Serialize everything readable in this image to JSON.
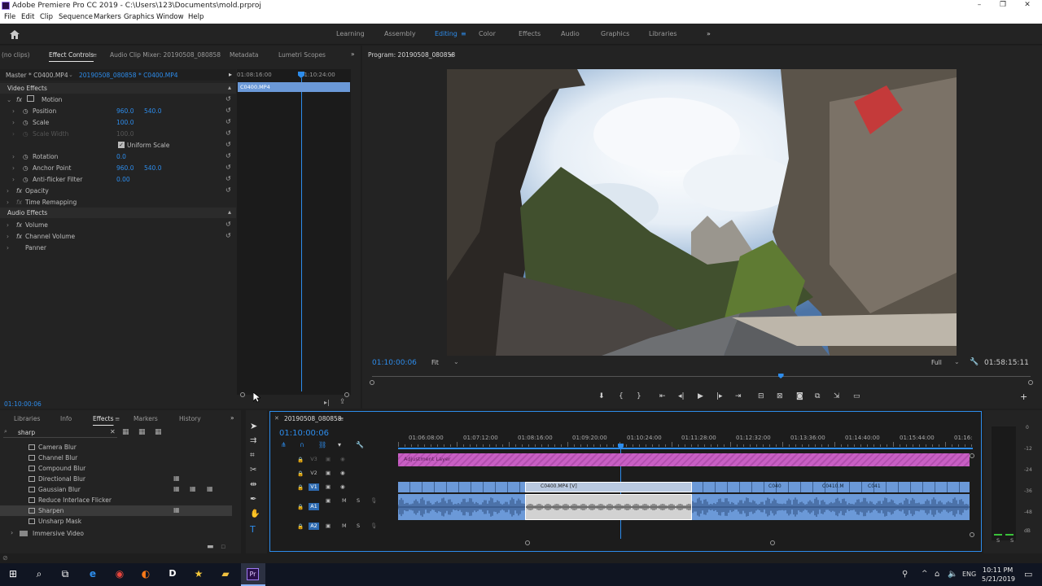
{
  "window": {
    "title": "Adobe Premiere Pro CC 2019 - C:\\Users\\123\\Documents\\mold.prproj",
    "minimize": "–",
    "maximize": "❐",
    "close": "✕"
  },
  "menu": [
    "File",
    "Edit",
    "Clip",
    "Sequence",
    "Markers",
    "Graphics",
    "Window",
    "Help"
  ],
  "workspaces": {
    "items": [
      "Learning",
      "Assembly",
      "Editing",
      "Color",
      "Effects",
      "Audio",
      "Graphics",
      "Libraries"
    ],
    "active": "Editing",
    "more": "»"
  },
  "source_panel": {
    "tabs": [
      "(no clips)",
      "Effect Controls",
      "Audio Clip Mixer: 20190508_080858",
      "Metadata",
      "Lumetri Scopes"
    ],
    "master": "Master * C0400.MP4",
    "clip": "20190508_080858 * C0400.MP4",
    "time_start": "01:08:16:00",
    "time_mid": "01:10:24:00",
    "clip_bar": "C0400.MP4",
    "video_effects": "Video Effects",
    "audio_effects": "Audio Effects",
    "rows": [
      {
        "label": "Motion",
        "v1": "",
        "v2": ""
      },
      {
        "label": "Position",
        "v1": "960.0",
        "v2": "540.0"
      },
      {
        "label": "Scale",
        "v1": "100.0",
        "v2": ""
      },
      {
        "label": "Scale Width",
        "v1": "100.0",
        "v2": ""
      },
      {
        "label": "Uniform Scale",
        "v1": "",
        "v2": ""
      },
      {
        "label": "Rotation",
        "v1": "0.0",
        "v2": ""
      },
      {
        "label": "Anchor Point",
        "v1": "960.0",
        "v2": "540.0"
      },
      {
        "label": "Anti-flicker Filter",
        "v1": "0.00",
        "v2": ""
      },
      {
        "label": "Opacity",
        "v1": "",
        "v2": ""
      },
      {
        "label": "Time Remapping",
        "v1": "",
        "v2": ""
      }
    ],
    "audio_rows": [
      "Volume",
      "Channel Volume",
      "Panner"
    ],
    "current_time": "01:10:00:06"
  },
  "program": {
    "title": "Program: 20190508_080858",
    "timecode": "01:10:00:06",
    "fit": "Fit",
    "full": "Full",
    "duration": "01:58:15:11",
    "playhead_pct": 62
  },
  "effects_panel": {
    "tabs": [
      "Libraries",
      "Info",
      "Effects",
      "Markers",
      "History"
    ],
    "search": "sharp",
    "items": [
      "Camera Blur",
      "Channel Blur",
      "Compound Blur",
      "Directional Blur",
      "Gaussian Blur",
      "Reduce Interlace Flicker",
      "Sharpen",
      "Unsharp Mask",
      "Immersive Video"
    ],
    "selected": "Sharpen"
  },
  "timeline": {
    "title": "20190508_080858",
    "timecode": "01:10:00:06",
    "ruler": [
      "01:06:08:00",
      "01:07:12:00",
      "01:08:16:00",
      "01:09:20:00",
      "01:10:24:00",
      "01:11:28:00",
      "01:12:32:00",
      "01:13:36:00",
      "01:14:40:00",
      "01:15:44:00",
      "01:16:"
    ],
    "tracks": {
      "v3": "V3",
      "v2": "V2",
      "v1": "V1",
      "a1": "A1",
      "a2": "A2"
    },
    "adjustment": "Adjustment Layer",
    "clip_main": "C0400.MP4 [V]",
    "clip_a": "C040",
    "clip_b": "C0410.M",
    "clip_c": "C041",
    "mute": "M",
    "solo": "S"
  },
  "meter": {
    "labels": [
      "0",
      "-12",
      "-24",
      "-36",
      "-48",
      "dB"
    ],
    "solo": "S"
  },
  "taskbar": {
    "time": "10:11 PM",
    "date": "5/21/2019",
    "lang": "ENG"
  },
  "colors": {
    "accent": "#2d8ceb",
    "adjustment": "#c85fc4",
    "clip_blue": "#6b99d8",
    "taskbar": "#101522"
  }
}
